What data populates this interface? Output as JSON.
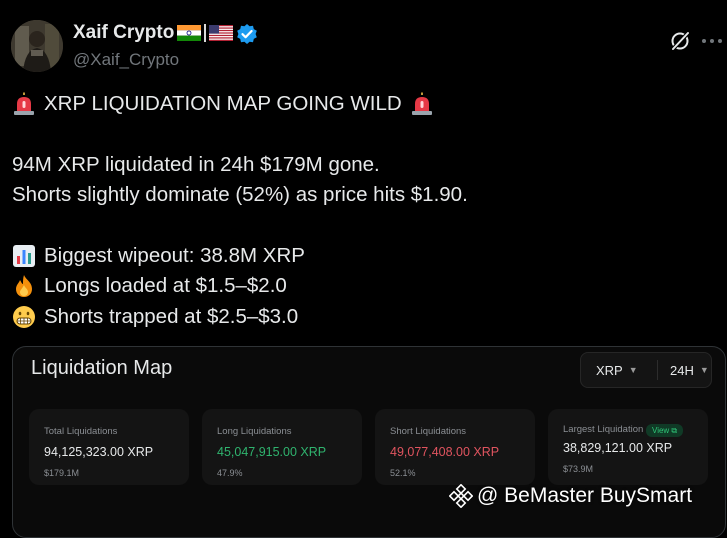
{
  "author": {
    "display_name": "Xaif Crypto",
    "handle": "@Xaif_Crypto",
    "flags": [
      "india-flag-icon",
      "usa-flag-icon"
    ],
    "verified": true
  },
  "post": {
    "headline": "XRP LIQUIDATION MAP GOING WILD",
    "line1": "94M XRP liquidated in 24h $179M gone.",
    "line2": "Shorts slightly dominate (52%) as price hits $1.90.",
    "bullet1": "Biggest wipeout: 38.8M XRP",
    "bullet2": "Longs loaded at $1.5–$2.0",
    "bullet3": "Shorts trapped at $2.5–$3.0"
  },
  "card": {
    "title": "Liquidation Map",
    "asset": "XRP",
    "timeframe": "24H",
    "stats": [
      {
        "label": "Total Liquidations",
        "value": "94,125,323.00 XRP",
        "sub": "$179.1M",
        "value_color": "#e7e9ea"
      },
      {
        "label": "Long Liquidations",
        "value": "45,047,915.00 XRP",
        "sub": "47.9%",
        "value_color": "#2fb36e"
      },
      {
        "label": "Short Liquidations",
        "value": "49,077,408.00 XRP",
        "sub": "52.1%",
        "value_color": "#e0545f"
      },
      {
        "label": "Largest Liquidation",
        "value": "38,829,121.00 XRP",
        "sub": "$73.9M",
        "badge": "View ⧉",
        "value_color": "#e7e9ea"
      }
    ]
  },
  "watermark": {
    "text": "@ BeMaster BuySmart"
  },
  "colors": {
    "background": "#000000",
    "text": "#e7e9ea",
    "muted": "#71767b",
    "verified": "#1d9bf0",
    "long": "#2fb36e",
    "short": "#e0545f"
  }
}
